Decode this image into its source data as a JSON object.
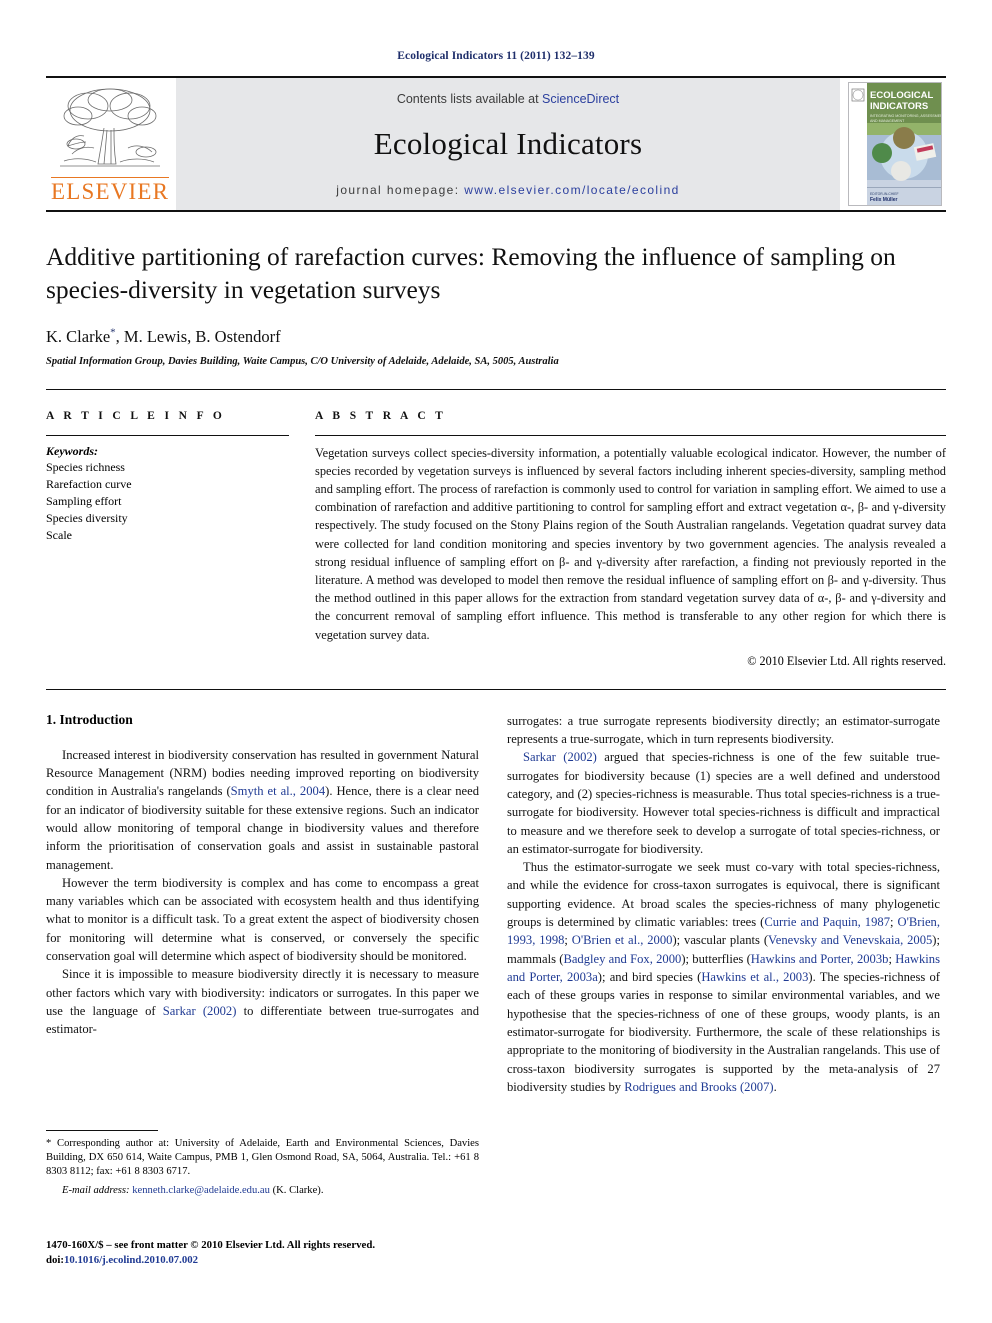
{
  "running_head": "Ecological Indicators 11 (2011) 132–139",
  "masthead": {
    "contents_prefix": "Contents lists available at ",
    "sciencedirect": "ScienceDirect",
    "journal_name": "Ecological Indicators",
    "homepage_label": "journal homepage: ",
    "homepage_url": "www.elsevier.com/locate/ecolind",
    "publisher": "ELSEVIER",
    "cover": {
      "line1": "ECOLOGICAL",
      "line2": "INDICATORS",
      "subtitle": "INTEGRATING MONITORING, ASSESSMENT AND MANAGEMENT"
    }
  },
  "article": {
    "title": "Additive partitioning of rarefaction curves: Removing the influence of sampling on species-diversity in vegetation surveys",
    "authors": "K. Clarke, M. Lewis, B. Ostendorf",
    "corresponding_marker": "*",
    "affiliation": "Spatial Information Group, Davies Building, Waite Campus, C/O University of Adelaide, Adelaide, SA, 5005, Australia"
  },
  "article_info": {
    "heading": "A R T I C L E   I N F O",
    "keywords_label": "Keywords:",
    "keywords": [
      "Species richness",
      "Rarefaction curve",
      "Sampling effort",
      "Species diversity",
      "Scale"
    ]
  },
  "abstract": {
    "heading": "A B S T R A C T",
    "text": "Vegetation surveys collect species-diversity information, a potentially valuable ecological indicator. However, the number of species recorded by vegetation surveys is influenced by several factors including inherent species-diversity, sampling method and sampling effort. The process of rarefaction is commonly used to control for variation in sampling effort. We aimed to use a combination of rarefaction and additive partitioning to control for sampling effort and extract vegetation α-, β- and γ-diversity respectively. The study focused on the Stony Plains region of the South Australian rangelands. Vegetation quadrat survey data were collected for land condition monitoring and species inventory by two government agencies. The analysis revealed a strong residual influence of sampling effort on β- and γ-diversity after rarefaction, a finding not previously reported in the literature. A method was developed to model then remove the residual influence of sampling effort on β- and γ-diversity. Thus the method outlined in this paper allows for the extraction from standard vegetation survey data of α-, β- and γ-diversity and the concurrent removal of sampling effort influence. This method is transferable to any other region for which there is vegetation survey data.",
    "copyright": "© 2010 Elsevier Ltd. All rights reserved."
  },
  "body": {
    "section_number_title": "1. Introduction",
    "left_paragraphs": [
      "Increased interest in biodiversity conservation has resulted in government Natural Resource Management (NRM) bodies needing improved reporting on biodiversity condition in Australia's rangelands (Smyth et al., 2004). Hence, there is a clear need for an indicator of biodiversity suitable for these extensive regions. Such an indicator would allow monitoring of temporal change in biodiversity values and therefore inform the prioritisation of conservation goals and assist in sustainable pastoral management.",
      "However the term biodiversity is complex and has come to encompass a great many variables which can be associated with ecosystem health and thus identifying what to monitor is a difficult task. To a great extent the aspect of biodiversity chosen for monitoring will determine what is conserved, or conversely the specific conservation goal will determine which aspect of biodiversity should be monitored.",
      "Since it is impossible to measure biodiversity directly it is necessary to measure other factors which vary with biodiversity: indicators or surrogates. In this paper we use the language of Sarkar (2002) to differentiate between true-surrogates and estimator-"
    ],
    "right_paragraphs": [
      "surrogates: a true surrogate represents biodiversity directly; an estimator-surrogate represents a true-surrogate, which in turn represents biodiversity.",
      "Sarkar (2002) argued that species-richness is one of the few suitable true-surrogates for biodiversity because (1) species are a well defined and understood category, and (2) species-richness is measurable. Thus total species-richness is a true-surrogate for biodiversity. However total species-richness is difficult and impractical to measure and we therefore seek to develop a surrogate of total species-richness, or an estimator-surrogate for biodiversity.",
      "Thus the estimator-surrogate we seek must co-vary with total species-richness, and while the evidence for cross-taxon surrogates is equivocal, there is significant supporting evidence. At broad scales the species-richness of many phylogenetic groups is determined by climatic variables: trees (Currie and Paquin, 1987; O'Brien, 1993, 1998; O'Brien et al., 2000); vascular plants (Venevsky and Venevskaia, 2005); mammals (Badgley and Fox, 2000); butterflies (Hawkins and Porter, 2003b; Hawkins and Porter, 2003a); and bird species (Hawkins et al., 2003). The species-richness of each of these groups varies in response to similar environmental variables, and we hypothesise that the species-richness of one of these groups, woody plants, is an estimator-surrogate for biodiversity. Furthermore, the scale of these relationships is appropriate to the monitoring of biodiversity in the Australian rangelands. This use of cross-taxon biodiversity surrogates is supported by the meta-analysis of 27 biodiversity studies by Rodrigues and Brooks (2007)."
    ]
  },
  "footnote": {
    "corresponding": "* Corresponding author at: University of Adelaide, Earth and Environmental Sciences, Davies Building, DX 650 614, Waite Campus, PMB 1, Glen Osmond Road, SA, 5064, Australia. Tel.: +61 8 8303 8112; fax: +61 8 8303 6717.",
    "email_label": "E-mail address:",
    "email": "kenneth.clarke@adelaide.edu.au",
    "email_suffix": "(K. Clarke)."
  },
  "footer": {
    "issn_line": "1470-160X/$ – see front matter © 2010 Elsevier Ltd. All rights reserved.",
    "doi_label": "doi:",
    "doi_value": "10.1016/j.ecolind.2010.07.002"
  },
  "colors": {
    "running_head": "#1f2f6b",
    "link": "#1f3a93",
    "elsevier_orange": "#E87722",
    "band_grey": "#e6e7e9"
  }
}
